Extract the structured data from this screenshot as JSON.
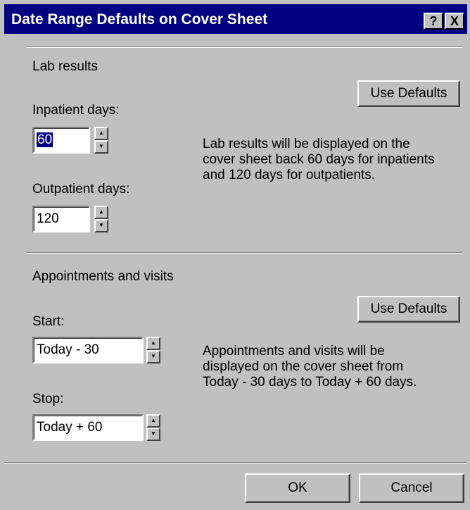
{
  "window": {
    "title": "Date Range Defaults on Cover Sheet",
    "help_label": "?",
    "close_label": "X"
  },
  "lab": {
    "heading": "Lab results",
    "use_defaults_label": "Use Defaults",
    "inpatient_label": "Inpatient days:",
    "inpatient_value": "60",
    "outpatient_label": "Outpatient days:",
    "outpatient_value": "120",
    "description": "Lab results will be displayed on the cover sheet back 60 days for inpatients and 120 days for outpatients."
  },
  "appointments": {
    "heading": "Appointments and visits",
    "use_defaults_label": "Use Defaults",
    "start_label": "Start:",
    "start_value": "Today - 30",
    "stop_label": "Stop:",
    "stop_value": "Today + 60",
    "description": "Appointments and visits will be displayed on the cover sheet from Today - 30 days to Today + 60 days."
  },
  "footer": {
    "ok_label": "OK",
    "cancel_label": "Cancel"
  },
  "spinner": {
    "up_glyph": "▲",
    "down_glyph": "▼"
  }
}
